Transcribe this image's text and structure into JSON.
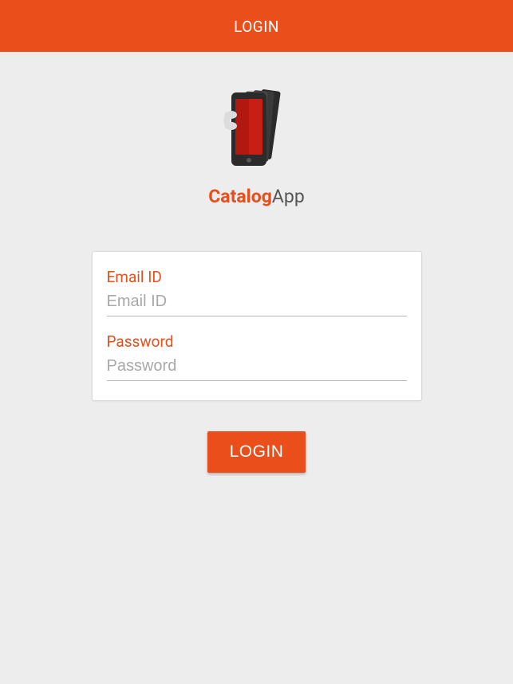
{
  "header": {
    "title": "LOGIN"
  },
  "brand": {
    "name_bold": "Catalog",
    "name_light": "App"
  },
  "form": {
    "email": {
      "label": "Email ID",
      "placeholder": "Email ID",
      "value": ""
    },
    "password": {
      "label": "Password",
      "placeholder": "Password",
      "value": ""
    }
  },
  "actions": {
    "login_label": "LOGIN"
  },
  "colors": {
    "accent": "#e94e1b",
    "background": "#ededed",
    "card_bg": "#ffffff",
    "placeholder": "#a8a8a8"
  }
}
